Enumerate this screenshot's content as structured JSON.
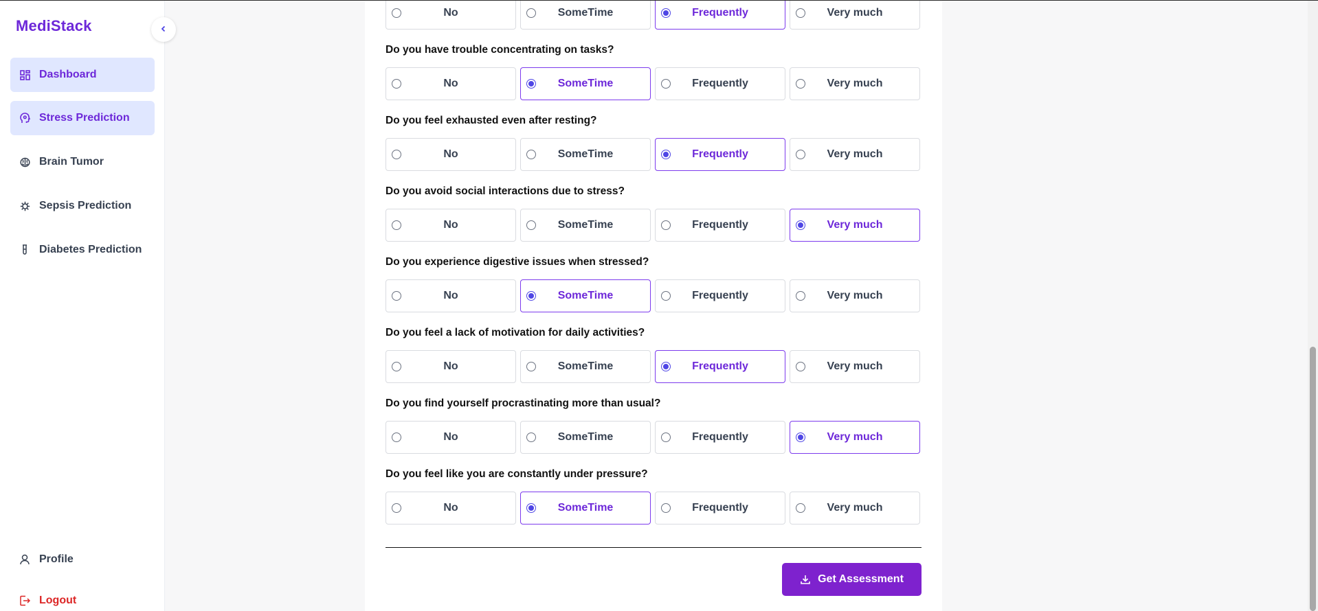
{
  "app": {
    "brand": "MediStack"
  },
  "sidebar": {
    "items": [
      {
        "label": "Dashboard",
        "icon": "dashboard-grid-icon",
        "active": true
      },
      {
        "label": "Stress Prediction",
        "icon": "brain-head-icon",
        "active": true
      },
      {
        "label": "Brain Tumor",
        "icon": "brain-icon",
        "active": false
      },
      {
        "label": "Sepsis Prediction",
        "icon": "virus-icon",
        "active": false
      },
      {
        "label": "Diabetes Prediction",
        "icon": "test-tube-icon",
        "active": false
      }
    ],
    "profile_label": "Profile",
    "logout_label": "Logout"
  },
  "options": [
    "No",
    "SomeTime",
    "Frequently",
    "Very much"
  ],
  "questions": [
    {
      "text": "",
      "selected": "Frequently"
    },
    {
      "text": "Do you have trouble concentrating on tasks?",
      "selected": "SomeTime"
    },
    {
      "text": "Do you feel exhausted even after resting?",
      "selected": "Frequently"
    },
    {
      "text": "Do you avoid social interactions due to stress?",
      "selected": "Very much"
    },
    {
      "text": "Do you experience digestive issues when stressed?",
      "selected": "SomeTime"
    },
    {
      "text": "Do you feel a lack of motivation for daily activities?",
      "selected": "Frequently"
    },
    {
      "text": "Do you find yourself procrastinating more than usual?",
      "selected": "Very much"
    },
    {
      "text": "Do you feel like you are constantly under pressure?",
      "selected": "SomeTime"
    }
  ],
  "submit": {
    "label": "Get Assessment",
    "icon": "download-icon"
  },
  "colors": {
    "accent": "#7e22ce",
    "brand": "#6d28d9",
    "active_bg": "#e0e7ff",
    "logout": "#dc2626"
  }
}
